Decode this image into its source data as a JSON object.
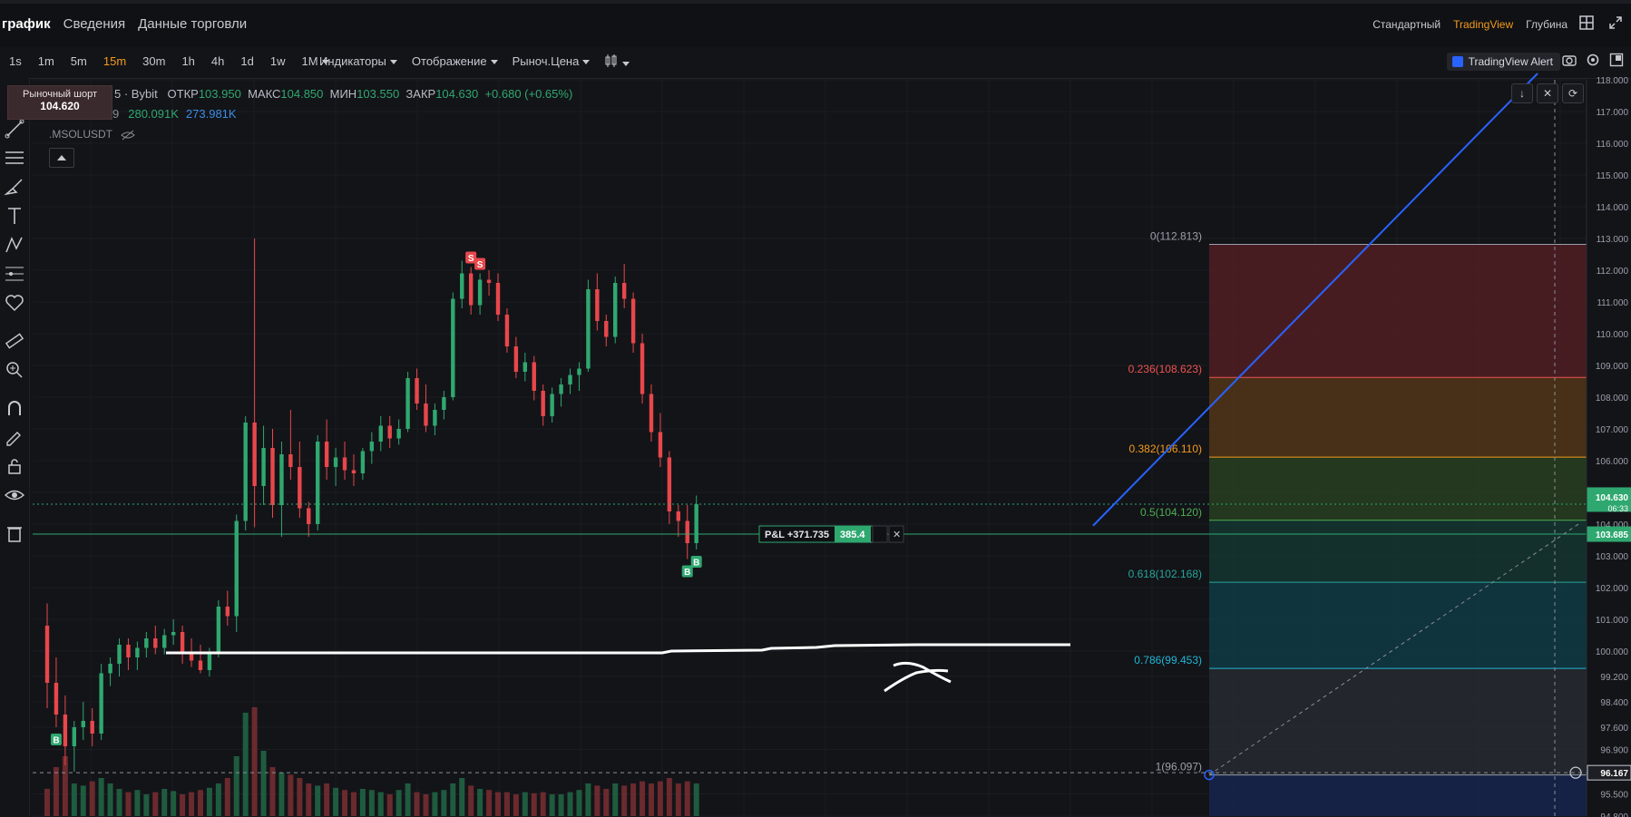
{
  "tabs": [
    "график",
    "Сведения",
    "Данные торговли"
  ],
  "views": [
    "Стандартный",
    "TradingView",
    "Глубина"
  ],
  "timeframes": [
    "1s",
    "1m",
    "5m",
    "15m",
    "30m",
    "1h",
    "4h",
    "1d",
    "1w",
    "1M"
  ],
  "active_timeframe": "15m",
  "menus": [
    "Индикаторы",
    "Отображение",
    "Рыноч.Цена"
  ],
  "alert_label": "TradingView Alert",
  "short_box": {
    "label": "Рыночный шорт",
    "price": "104.620"
  },
  "ohlc": {
    "exchange": "5 · Bybit",
    "open_label": "ОТКР",
    "open": "103.950",
    "high_label": "МАКС",
    "high": "104.850",
    "low_label": "МИН",
    "low": "103.550",
    "close_label": "ЗАКР",
    "close": "104.630",
    "change": "+0.680 (+0.65%)"
  },
  "volume": {
    "prefix": "9",
    "v1": "280.091K",
    "v2": "273.981K"
  },
  "symbol": ".MSOLUSDT",
  "pnl": {
    "label": "P&L +371.735",
    "qty": "385.4"
  },
  "fib_levels": [
    {
      "label": "0(112.813)",
      "price": 112.813,
      "color": "#9aa0aa"
    },
    {
      "label": "0.236(108.623)",
      "price": 108.623,
      "color": "#f05350"
    },
    {
      "label": "0.382(106.110)",
      "price": 106.11,
      "color": "#f39a1e"
    },
    {
      "label": "0.5(104.120)",
      "price": 104.12,
      "color": "#4caf50"
    },
    {
      "label": "0.618(102.168)",
      "price": 102.168,
      "color": "#26a69a"
    },
    {
      "label": "0.786(99.453)",
      "price": 99.453,
      "color": "#1fb6d6"
    },
    {
      "label": "1(96.097)",
      "price": 96.097,
      "color": "#9aa0aa"
    }
  ],
  "axis_ticks": [
    "118.000",
    "117.000",
    "116.000",
    "115.000",
    "114.000",
    "113.000",
    "112.000",
    "111.000",
    "110.000",
    "109.000",
    "108.000",
    "107.000",
    "106.000",
    "105.000",
    "104.000",
    "103.000",
    "102.000",
    "101.000",
    "100.000",
    "99.200",
    "98.400",
    "97.600",
    "96.900",
    "95.500",
    "94.800"
  ],
  "axis_tick_values": [
    118,
    117,
    116,
    115,
    114,
    113,
    112,
    111,
    110,
    109,
    108,
    107,
    106,
    105,
    104,
    103,
    102,
    101,
    100,
    99.2,
    98.4,
    97.6,
    96.9,
    95.5,
    94.8
  ],
  "price_badges": [
    {
      "label": "104.630",
      "sub": "06:33",
      "price": 104.63,
      "bg": "#2fa870"
    },
    {
      "label": "103.685",
      "price": 103.685,
      "bg": "#2fa870"
    },
    {
      "label": "96.167",
      "price": 96.167,
      "bg": "#1e1f24"
    }
  ],
  "colors": {
    "up": "#2fa870",
    "down": "#e8474b",
    "accent": "#f39a1e",
    "trendline": "#2962ff"
  },
  "chart_data": {
    "type": "candlestick",
    "ylim": [
      94.8,
      118
    ],
    "candles": [
      [
        100.8,
        101.5,
        98.2,
        99
      ],
      [
        99,
        99.8,
        97.6,
        98
      ],
      [
        98,
        98.6,
        96.4,
        97
      ],
      [
        97,
        97.8,
        96.2,
        97.6
      ],
      [
        97.6,
        98.4,
        97.2,
        97.8
      ],
      [
        97.8,
        98.2,
        97,
        97.4
      ],
      [
        97.4,
        99.6,
        97.2,
        99.3
      ],
      [
        99.3,
        99.8,
        98.9,
        99.6
      ],
      [
        99.6,
        100.4,
        99.2,
        100.2
      ],
      [
        100.2,
        100.4,
        99.4,
        99.8
      ],
      [
        99.8,
        100.3,
        99.4,
        100.1
      ],
      [
        100.1,
        100.6,
        99.8,
        100.4
      ],
      [
        100.4,
        100.8,
        99.9,
        100.1
      ],
      [
        100.1,
        100.7,
        99.9,
        100.5
      ],
      [
        100.5,
        101,
        100.2,
        100.6
      ],
      [
        100.6,
        100.8,
        99.6,
        99.9
      ],
      [
        99.9,
        100.4,
        99.5,
        99.7
      ],
      [
        99.7,
        100.2,
        99.3,
        99.4
      ],
      [
        99.4,
        100.1,
        99.2,
        99.9
      ],
      [
        99.9,
        101.6,
        99.8,
        101.4
      ],
      [
        101.4,
        101.9,
        100.8,
        101.1
      ],
      [
        101.1,
        104.3,
        100.6,
        104.1
      ],
      [
        104.1,
        107.4,
        103.8,
        107.2
      ],
      [
        107.2,
        113,
        103.9,
        105.2
      ],
      [
        105.2,
        107.1,
        104.6,
        106.4
      ],
      [
        106.4,
        107,
        104.2,
        104.6
      ],
      [
        104.6,
        106.6,
        103.6,
        106.2
      ],
      [
        106.2,
        107.6,
        105.4,
        105.8
      ],
      [
        105.8,
        106.6,
        104.2,
        104.5
      ],
      [
        104.5,
        104.7,
        103.6,
        104
      ],
      [
        104,
        106.8,
        103.8,
        106.6
      ],
      [
        106.6,
        107.3,
        105.4,
        105.8
      ],
      [
        105.8,
        106.4,
        105.2,
        106.1
      ],
      [
        106.1,
        106.6,
        105.4,
        105.7
      ],
      [
        105.7,
        106.2,
        105.2,
        105.6
      ],
      [
        105.6,
        106.4,
        105.4,
        106.3
      ],
      [
        106.3,
        106.9,
        105.9,
        106.6
      ],
      [
        106.6,
        107.4,
        106.3,
        107.1
      ],
      [
        107.1,
        107.4,
        106.4,
        106.7
      ],
      [
        106.7,
        107.3,
        106.5,
        107
      ],
      [
        107,
        108.8,
        106.9,
        108.6
      ],
      [
        108.6,
        108.9,
        107.6,
        107.8
      ],
      [
        107.8,
        108.4,
        106.9,
        107.1
      ],
      [
        107.1,
        107.8,
        106.8,
        107.6
      ],
      [
        107.6,
        108.2,
        107.3,
        108
      ],
      [
        108,
        111.3,
        107.9,
        111.1
      ],
      [
        111.1,
        112.3,
        110.8,
        111.9
      ],
      [
        111.9,
        112.1,
        110.6,
        110.9
      ],
      [
        110.9,
        111.9,
        110.6,
        111.7
      ],
      [
        111.7,
        112,
        111.2,
        111.6
      ],
      [
        111.6,
        111.9,
        110.4,
        110.6
      ],
      [
        110.6,
        110.8,
        109.4,
        109.6
      ],
      [
        109.6,
        109.9,
        108.6,
        108.8
      ],
      [
        108.8,
        109.4,
        108.5,
        109.1
      ],
      [
        109.1,
        109.3,
        107.9,
        108.2
      ],
      [
        108.2,
        108.4,
        107.1,
        107.4
      ],
      [
        107.4,
        108.3,
        107.2,
        108.1
      ],
      [
        108.1,
        108.6,
        107.7,
        108.4
      ],
      [
        108.4,
        108.9,
        108.1,
        108.7
      ],
      [
        108.7,
        109.1,
        108.2,
        108.9
      ],
      [
        108.9,
        111.7,
        108.8,
        111.4
      ],
      [
        111.4,
        111.9,
        110.1,
        110.4
      ],
      [
        110.4,
        110.6,
        109.6,
        109.9
      ],
      [
        109.9,
        111.8,
        109.7,
        111.6
      ],
      [
        111.6,
        112.2,
        110.8,
        111.1
      ],
      [
        111.1,
        111.3,
        109.4,
        109.7
      ],
      [
        109.7,
        110,
        107.8,
        108.1
      ],
      [
        108.1,
        108.4,
        106.6,
        106.9
      ],
      [
        106.9,
        107.5,
        105.8,
        106.1
      ],
      [
        106.1,
        106.3,
        104,
        104.4
      ],
      [
        104.4,
        104.6,
        103.6,
        104.1
      ],
      [
        104.1,
        104.6,
        102.9,
        103.4
      ],
      [
        103.4,
        104.9,
        103.2,
        104.63
      ]
    ],
    "volumes": [
      0.25,
      0.45,
      0.55,
      0.3,
      0.28,
      0.32,
      0.35,
      0.3,
      0.25,
      0.22,
      0.24,
      0.2,
      0.22,
      0.25,
      0.23,
      0.2,
      0.22,
      0.24,
      0.26,
      0.3,
      0.35,
      0.55,
      0.95,
      1.0,
      0.6,
      0.45,
      0.4,
      0.38,
      0.35,
      0.3,
      0.28,
      0.3,
      0.26,
      0.24,
      0.22,
      0.25,
      0.24,
      0.22,
      0.2,
      0.24,
      0.3,
      0.22,
      0.2,
      0.22,
      0.24,
      0.3,
      0.35,
      0.28,
      0.25,
      0.24,
      0.22,
      0.22,
      0.2,
      0.22,
      0.21,
      0.22,
      0.2,
      0.2,
      0.22,
      0.24,
      0.3,
      0.28,
      0.25,
      0.3,
      0.28,
      0.3,
      0.32,
      0.3,
      0.32,
      0.35,
      0.3,
      0.32,
      0.3
    ],
    "markers": [
      {
        "type": "B",
        "index": 1,
        "side": "below"
      },
      {
        "type": "S",
        "index": 47,
        "side": "above"
      },
      {
        "type": "S",
        "index": 48,
        "side": "above"
      },
      {
        "type": "B",
        "index": 71,
        "side": "below"
      },
      {
        "type": "B",
        "index": 72,
        "side": "below"
      }
    ]
  }
}
